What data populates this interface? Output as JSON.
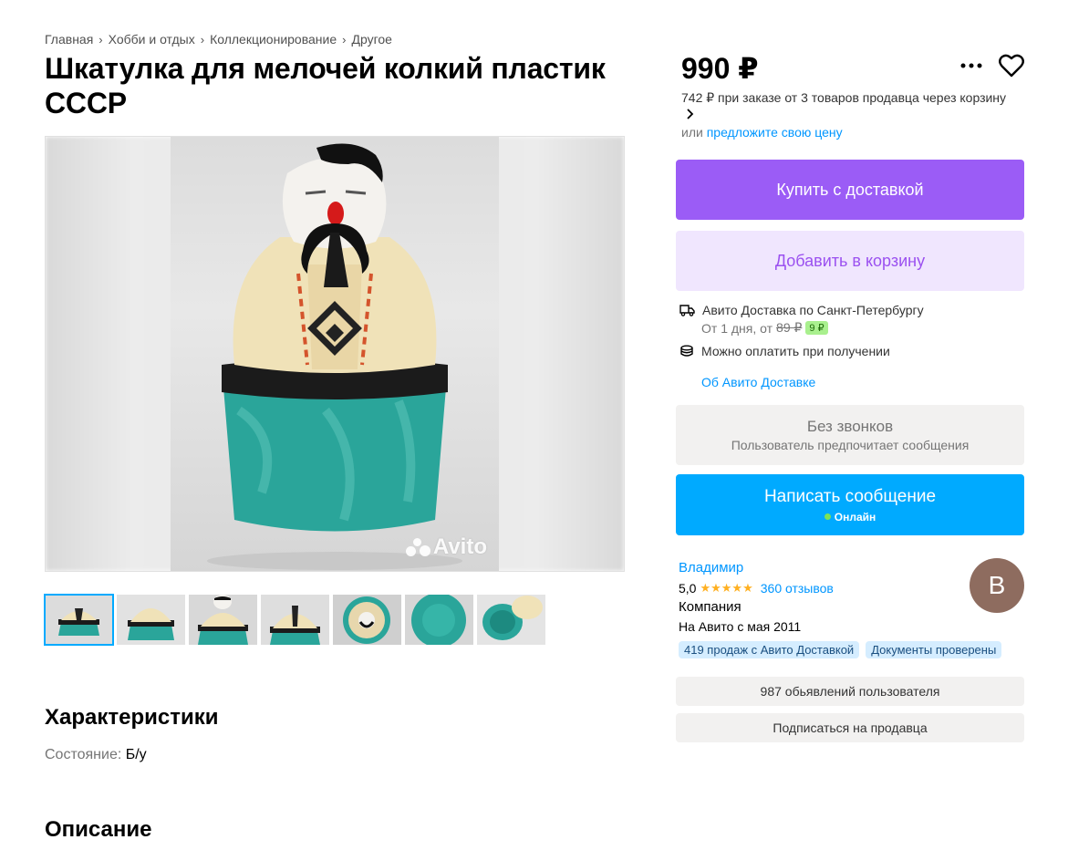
{
  "breadcrumbs": [
    "Главная",
    "Хобби и отдых",
    "Коллекционирование",
    "Другое"
  ],
  "title": "Шкатулка для мелочей колкий пластик СССР",
  "photo": {
    "watermark": "Avito"
  },
  "sections": {
    "characteristics": "Характеристики",
    "description": "Описание"
  },
  "characteristics": {
    "condition_label": "Состояние:",
    "condition_value": "Б/у"
  },
  "price": {
    "value": "990 ₽",
    "cart_note": "742 ₽ при заказе от 3 товаров продавца через корзину",
    "offer_prefix": "или",
    "offer_link": "предложите свою цену"
  },
  "buttons": {
    "buy": "Купить с доставкой",
    "cart": "Добавить в корзину",
    "calls_title": "Без звонков",
    "calls_sub": "Пользователь предпочитает сообщения",
    "message": "Написать сообщение",
    "message_status": "Онлайн"
  },
  "delivery": {
    "title": "Авито Доставка по Санкт-Петербургу",
    "terms": "От 1 дня, от",
    "old_price": "89 ₽",
    "new_price": "9 ₽",
    "payment": "Можно оплатить при получении",
    "link": "Об Авито Доставке"
  },
  "seller": {
    "name": "Владимир",
    "rating": "5,0",
    "stars": "★★★★★",
    "reviews": "360 отзывов",
    "type": "Компания",
    "since": "На Авито с мая 2011",
    "avatar_letter": "В",
    "tags": [
      "419 продаж с Авито Доставкой",
      "Документы проверены"
    ],
    "listings": "987 обьявлений пользователя",
    "subscribe": "Подписаться на продавца"
  },
  "colors": {
    "accent_purple": "#9b5cf6",
    "accent_blue": "#00aaff",
    "online": "#7ce356",
    "star": "#ffb021"
  }
}
